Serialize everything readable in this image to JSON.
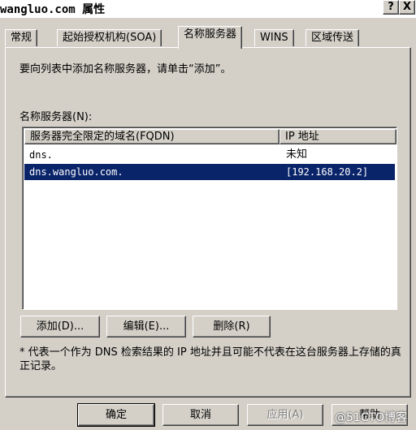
{
  "window": {
    "title": "wangluo.com 属性",
    "help_glyph": "?",
    "close_glyph": "X"
  },
  "tabs": [
    {
      "label": "常规"
    },
    {
      "label": "起始授权机构(SOA)"
    },
    {
      "label": "名称服务器"
    },
    {
      "label": "WINS"
    },
    {
      "label": "区域传送"
    }
  ],
  "instruction": "要向列表中添加名称服务器，请单击“添加”。",
  "list_label": "名称服务器(N):",
  "list": {
    "columns": [
      "服务器完全限定的域名(FQDN)",
      "IP 地址"
    ],
    "rows": [
      {
        "fqdn": "dns.",
        "ip": "未知",
        "selected": false
      },
      {
        "fqdn": "dns.wangluo.com.",
        "ip": "[192.168.20.2]",
        "selected": true
      }
    ]
  },
  "actions": {
    "add": "添加(D)...",
    "edit": "编辑(E)...",
    "remove": "删除(R)"
  },
  "note": "* 代表一个作为 DNS 检索结果的 IP 地址并且可能不代表在这台服务器上存储的真正记录。",
  "footer": {
    "ok": "确定",
    "cancel": "取消",
    "apply": "应用(A)",
    "help": "帮助"
  },
  "watermark": "@51CTO博客"
}
